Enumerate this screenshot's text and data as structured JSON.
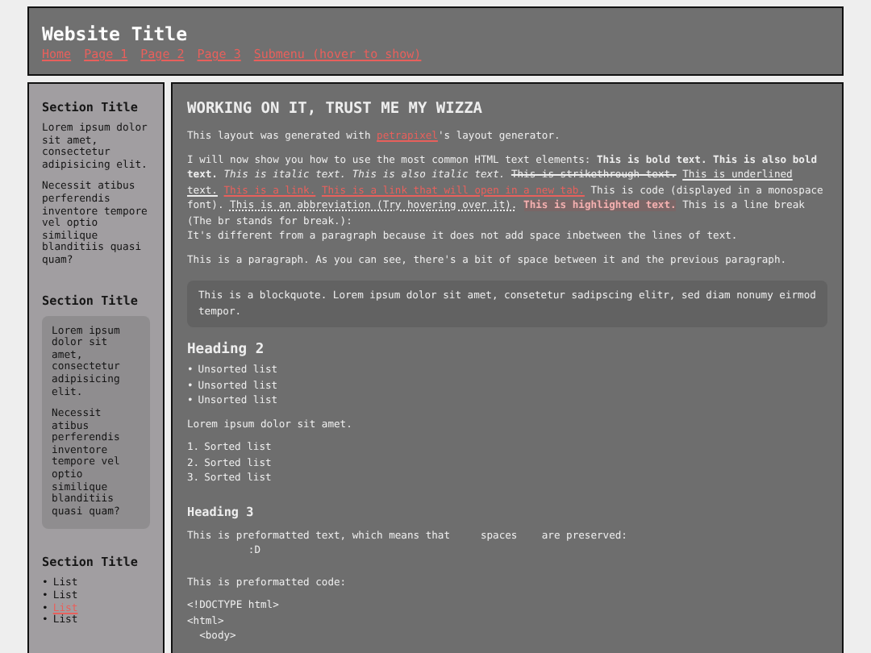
{
  "header": {
    "title": "Website Title",
    "nav": [
      "Home",
      "Page 1",
      "Page 2",
      "Page 3",
      "Submenu (hover to show)"
    ]
  },
  "sidebar": [
    {
      "kind": "plain",
      "title": "Section Title",
      "paragraphs": [
        "Lorem ipsum dolor sit amet, consectetur adipisicing elit.",
        "Necessit atibus perferendis inventore tempore vel optio similique blanditiis quasi quam?"
      ]
    },
    {
      "kind": "box",
      "title": "Section Title",
      "paragraphs": [
        "Lorem ipsum dolor sit amet, consectetur adipisicing elit.",
        "Necessit atibus perferendis inventore tempore vel optio similique blanditiis quasi quam?"
      ]
    },
    {
      "kind": "list",
      "title": "Section Title",
      "items": [
        {
          "bullet": "•",
          "text": "List",
          "link": false
        },
        {
          "bullet": "•",
          "text": "List",
          "link": false
        },
        {
          "bullet": "•",
          "text": "List",
          "link": true
        },
        {
          "bullet": "•",
          "text": "List",
          "link": false
        }
      ]
    }
  ],
  "main": [
    {
      "kind": "title",
      "text": "WORKING ON IT, TRUST ME MY WIZZA"
    },
    {
      "kind": "paragraph",
      "lines": [
        [
          {
            "kind": "text",
            "text": "This layout was generated with "
          },
          {
            "kind": "link",
            "text": "petrapixel"
          },
          {
            "kind": "text",
            "text": "'s layout generator."
          }
        ]
      ]
    },
    {
      "kind": "paragraph",
      "lines": [
        [
          {
            "kind": "text",
            "text": "I will now show you how to use the most common HTML text elements: "
          },
          {
            "kind": "bold",
            "text": "This is bold text. This is also bold text."
          },
          {
            "kind": "space"
          },
          {
            "kind": "italic",
            "text": "This is italic text. This is also italic text."
          },
          {
            "kind": "space"
          },
          {
            "kind": "strike",
            "text": "This is strikethrough text."
          },
          {
            "kind": "space"
          },
          {
            "kind": "underline",
            "text": "This is underlined text."
          },
          {
            "kind": "space"
          },
          {
            "kind": "link",
            "text": "This is a link."
          },
          {
            "kind": "space"
          },
          {
            "kind": "link",
            "text": "This is a link that will open in a new tab."
          },
          {
            "kind": "space"
          },
          {
            "kind": "code",
            "text": "This is code"
          },
          {
            "kind": "text",
            "text": " (displayed in a monospace font). "
          },
          {
            "kind": "abbr",
            "text": "This is an abbreviation (Try hovering over it)."
          },
          {
            "kind": "space"
          },
          {
            "kind": "mark",
            "text": "This is highlighted text."
          },
          {
            "kind": "text",
            "text": " This is a line break (The br stands for break.):"
          }
        ],
        [
          {
            "kind": "text",
            "text": "It's different from a paragraph because it does not add space inbetween the lines of text."
          }
        ]
      ]
    },
    {
      "kind": "paragraph",
      "lines": [
        [
          {
            "kind": "text",
            "text": "This is a paragraph. As you can see, there's a bit of space between it and the previous paragraph."
          }
        ]
      ]
    },
    {
      "kind": "blockquote",
      "text": "This is a blockquote. Lorem ipsum dolor sit amet, consetetur sadipscing elitr, sed diam nonumy eirmod tempor."
    },
    {
      "kind": "heading2",
      "text": "Heading 2"
    },
    {
      "kind": "list",
      "items": [
        {
          "marker": "•",
          "text": "Unsorted list"
        },
        {
          "marker": "•",
          "text": "Unsorted list"
        },
        {
          "marker": "•",
          "text": "Unsorted list"
        }
      ]
    },
    {
      "kind": "paragraph",
      "lines": [
        [
          {
            "kind": "text",
            "text": "Lorem ipsum dolor sit amet."
          }
        ]
      ]
    },
    {
      "kind": "list",
      "items": [
        {
          "marker": "1.",
          "text": "Sorted list"
        },
        {
          "marker": "2.",
          "text": "Sorted list"
        },
        {
          "marker": "3.",
          "text": "Sorted list"
        }
      ]
    },
    {
      "kind": "heading3",
      "text": "Heading 3"
    },
    {
      "kind": "pre",
      "lines": [
        "This is preformatted text, which means that     spaces    are preserved:",
        "          :D"
      ]
    },
    {
      "kind": "paragraph",
      "lines": [
        [
          {
            "kind": "text",
            "text": "This is preformatted code:"
          }
        ]
      ]
    },
    {
      "kind": "pre",
      "lines": [
        "<!DOCTYPE html>",
        "<html>",
        "  <body>"
      ]
    }
  ]
}
